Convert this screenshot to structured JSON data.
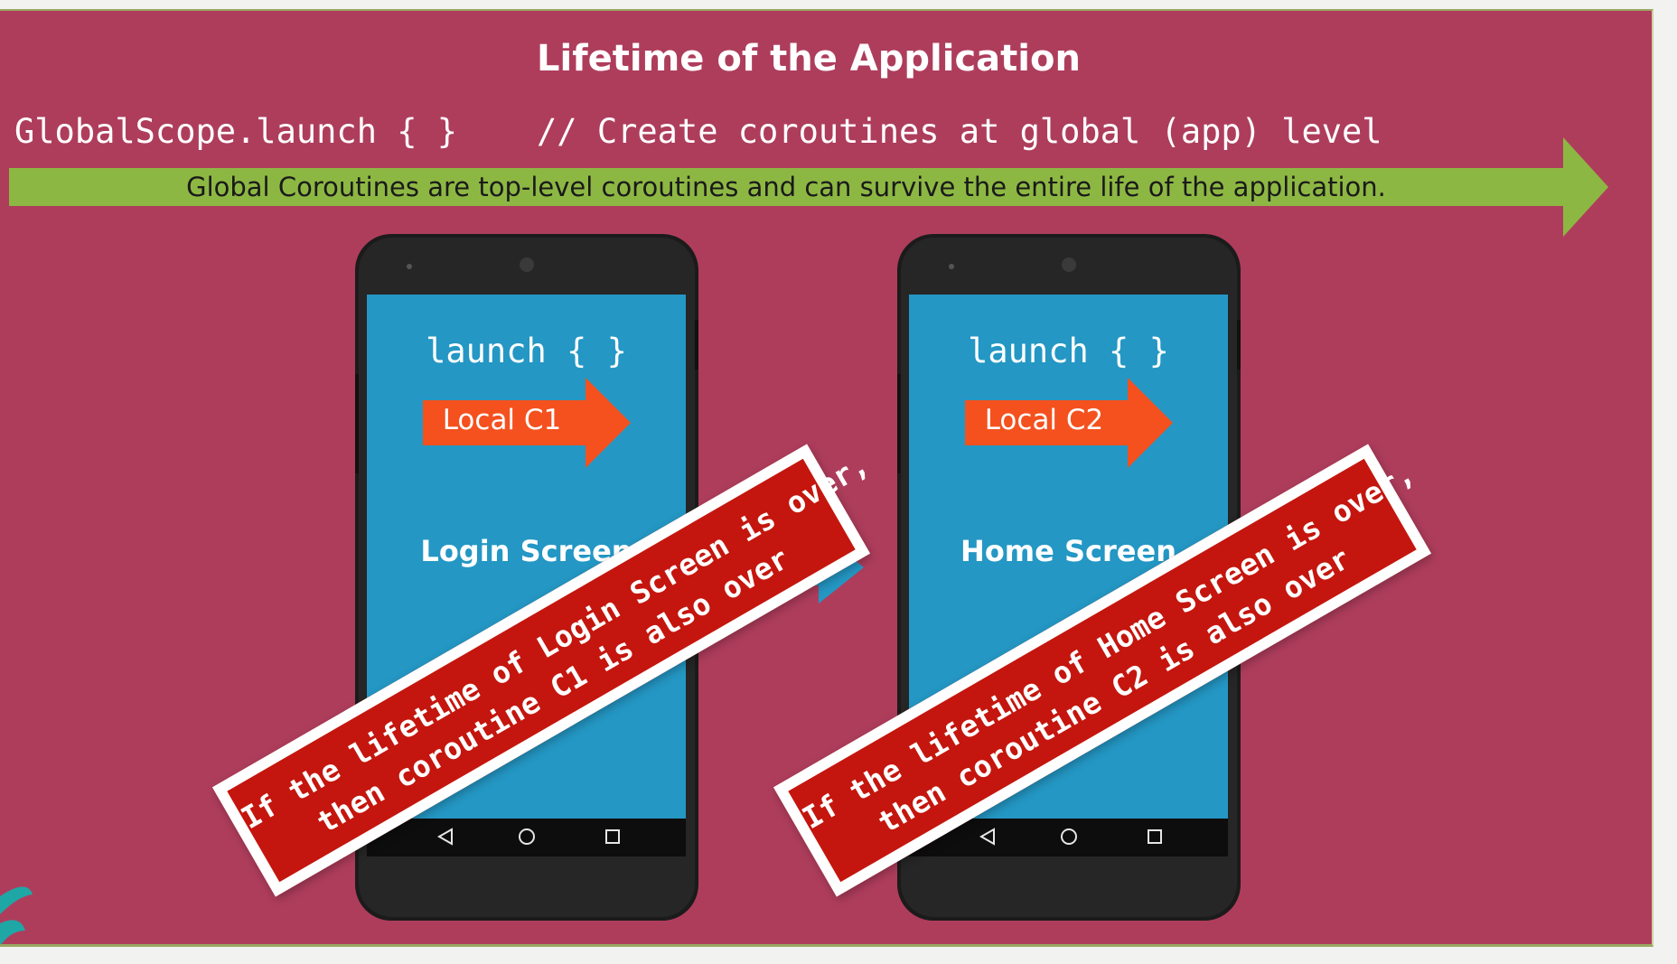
{
  "slide": {
    "title": "Lifetime of the Application",
    "code": "GlobalScope.launch { }",
    "code_comment": "// Create coroutines at global (app) level",
    "global_banner": "Global Coroutines are top-level coroutines and can survive the entire life of the application.",
    "colors": {
      "background": "#ae3d5c",
      "global_arrow": "#8db743",
      "local_arrow": "#f4511e",
      "screen": "#2497c4",
      "warning_banner": "#c4160e"
    }
  },
  "phones": [
    {
      "launch": "launch { }",
      "local_coroutine": "Local C1",
      "screen_name": "Login Screen",
      "nav_icons": [
        "back-icon",
        "home-icon",
        "recents-icon"
      ],
      "warning_line_1": "If the lifetime of Login Screen is over,",
      "warning_line_2": "then coroutine C1 is also over"
    },
    {
      "launch": "launch { }",
      "local_coroutine": "Local C2",
      "screen_name": "Home Screen",
      "nav_icons": [
        "back-icon",
        "home-icon",
        "recents-icon"
      ],
      "warning_line_1": "If the lifetime of Home Screen is over,",
      "warning_line_2": "then coroutine C2 is also over"
    }
  ]
}
